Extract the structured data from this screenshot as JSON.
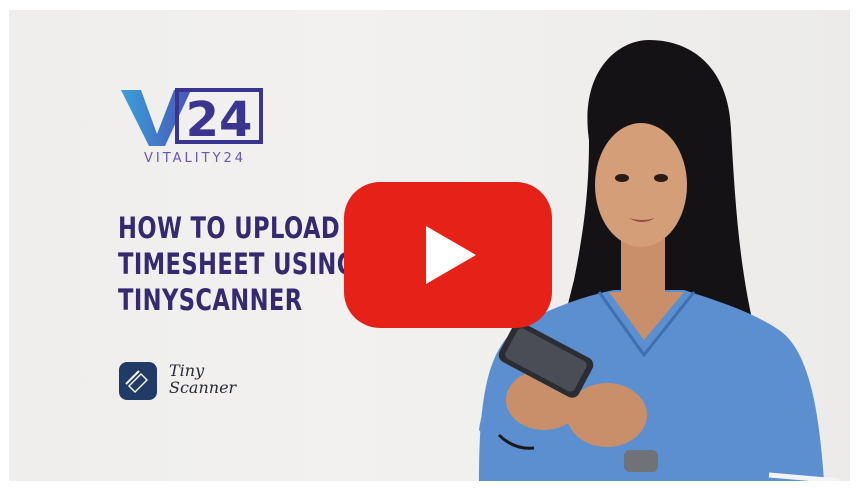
{
  "video": {
    "logo": {
      "mark": "V24",
      "subtitle": "VITALITY24"
    },
    "headline": {
      "lines": [
        "HOW TO UPLOAD YO",
        "TIMESHEET USING",
        "TINYSCANNER"
      ]
    },
    "tiny_scanner": {
      "line1": "Tiny",
      "line2": "Scanner"
    },
    "play_button": {
      "icon": "youtube-play-icon",
      "color": "#e62117"
    },
    "colors": {
      "brand_dark": "#35296f",
      "brand_light": "#6a55b5",
      "logo_blue": "#3b9fd8",
      "scrub_blue": "#5b8fd0"
    }
  }
}
